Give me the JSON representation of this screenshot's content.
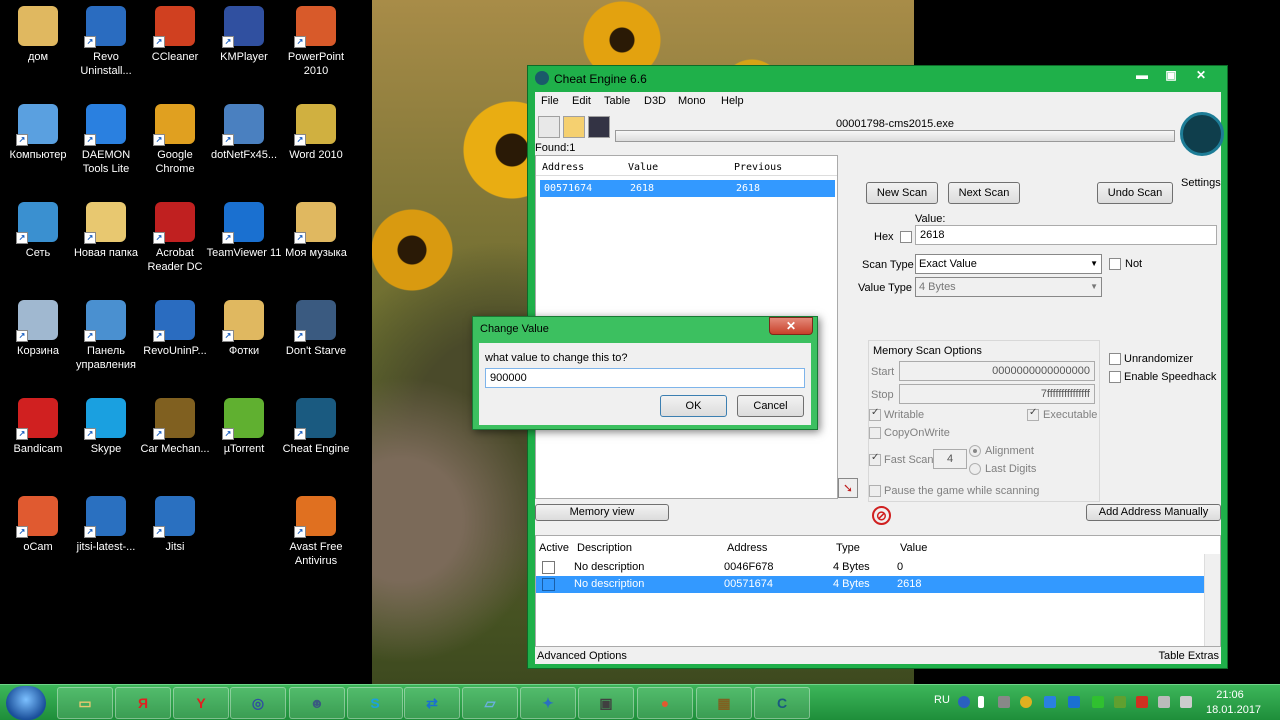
{
  "desktop_icons": [
    {
      "label": "дом",
      "icon": "user-folder-icon",
      "color": "#e0b860"
    },
    {
      "label": "Revo Uninstall...",
      "icon": "revo-icon",
      "color": "#2a6cc0"
    },
    {
      "label": "CCleaner",
      "icon": "ccleaner-icon",
      "color": "#d04020"
    },
    {
      "label": "KMPlayer",
      "icon": "kmplayer-icon",
      "color": "#3050a0"
    },
    {
      "label": "PowerPoint 2010",
      "icon": "powerpoint-icon",
      "color": "#d85a2a"
    },
    {
      "label": "Компьютер",
      "icon": "computer-icon",
      "color": "#5aa0e0"
    },
    {
      "label": "DAEMON Tools Lite",
      "icon": "daemon-tools-icon",
      "color": "#2a80e0"
    },
    {
      "label": "Google Chrome",
      "icon": "chrome-icon",
      "color": "#e0a020"
    },
    {
      "label": "dotNetFx45...",
      "icon": "installer-icon",
      "color": "#4a80c0"
    },
    {
      "label": "Word 2010",
      "icon": "word-icon",
      "color": "#d0b040"
    },
    {
      "label": "Сеть",
      "icon": "network-icon",
      "color": "#3a90d0"
    },
    {
      "label": "Новая папка",
      "icon": "folder-icon",
      "color": "#e8c870"
    },
    {
      "label": "Acrobat Reader DC",
      "icon": "acrobat-icon",
      "color": "#c02020"
    },
    {
      "label": "TeamViewer 11",
      "icon": "teamviewer-icon",
      "color": "#1a70d0"
    },
    {
      "label": "Моя музыка",
      "icon": "music-folder-icon",
      "color": "#e0b860"
    },
    {
      "label": "Корзина",
      "icon": "recycle-bin-icon",
      "color": "#a0b8d0"
    },
    {
      "label": "Панель управления",
      "icon": "control-panel-icon",
      "color": "#4a90d0"
    },
    {
      "label": "RevoUninP...",
      "icon": "revo-pro-icon",
      "color": "#2a6cc0"
    },
    {
      "label": "Фотки",
      "icon": "photos-folder-icon",
      "color": "#e0b860"
    },
    {
      "label": "Don't Starve",
      "icon": "dont-starve-icon",
      "color": "#3a5a80"
    },
    {
      "label": "Bandicam",
      "icon": "bandicam-icon",
      "color": "#d02020"
    },
    {
      "label": "Skype",
      "icon": "skype-icon",
      "color": "#1aa0e0"
    },
    {
      "label": "Car Mechan...",
      "icon": "car-mechanic-icon",
      "color": "#806020"
    },
    {
      "label": "µTorrent",
      "icon": "utorrent-icon",
      "color": "#60b030"
    },
    {
      "label": "Cheat Engine",
      "icon": "cheat-engine-icon",
      "color": "#1a5a80"
    },
    {
      "label": "oCam",
      "icon": "ocam-icon",
      "color": "#e05a30"
    },
    {
      "label": "jitsi-latest-...",
      "icon": "jitsi-icon",
      "color": "#2a70c0"
    },
    {
      "label": "Jitsi",
      "icon": "jitsi-icon",
      "color": "#2a70c0"
    },
    {
      "label": "",
      "icon": "none",
      "color": "#000000"
    },
    {
      "label": "Avast Free Antivirus",
      "icon": "avast-icon",
      "color": "#e07020"
    }
  ],
  "window": {
    "title": "Cheat Engine 6.6",
    "min": "▬",
    "max": "▣",
    "close": "✕",
    "menu": [
      "File",
      "Edit",
      "Table",
      "D3D",
      "Mono",
      "Help"
    ],
    "process": "00001798-cms2015.exe",
    "found": "Found:1",
    "settings": "Settings",
    "results": {
      "columns": [
        "Address",
        "Value",
        "Previous"
      ],
      "rows": [
        {
          "address": "00571674",
          "value": "2618",
          "previous": "2618"
        }
      ]
    },
    "buttons": {
      "new_scan": "New Scan",
      "next_scan": "Next Scan",
      "undo_scan": "Undo Scan"
    },
    "value_label": "Value:",
    "hex_label": "Hex",
    "value": "2618",
    "scan_type_label": "Scan Type",
    "scan_type": "Exact Value",
    "value_type_label": "Value Type",
    "value_type": "4 Bytes",
    "not_label": "Not",
    "memory_scan_options": "Memory Scan Options",
    "start_label": "Start",
    "start_value": "0000000000000000",
    "stop_label": "Stop",
    "stop_value": "7fffffffffffffff",
    "writable": "Writable",
    "executable": "Executable",
    "copyonwrite": "CopyOnWrite",
    "fast_scan": "Fast Scan",
    "fast_scan_value": "4",
    "alignment": "Alignment",
    "last_digits": "Last Digits",
    "pause_game": "Pause the game while scanning",
    "unrandomizer": "Unrandomizer",
    "speedhack": "Enable Speedhack",
    "memory_view": "Memory view",
    "add_manually": "Add Address Manually",
    "address_list": {
      "columns": [
        "Active",
        "Description",
        "Address",
        "Type",
        "Value"
      ],
      "rows": [
        {
          "description": "No description",
          "address": "0046F678",
          "type": "4 Bytes",
          "value": "0"
        },
        {
          "description": "No description",
          "address": "00571674",
          "type": "4 Bytes",
          "value": "2618"
        }
      ]
    },
    "advanced_options": "Advanced Options",
    "table_extras": "Table Extras"
  },
  "dialog": {
    "title": "Change Value",
    "close": "✕",
    "prompt": "what value to change this to?",
    "input": "900000",
    "ok": "OK",
    "cancel": "Cancel"
  },
  "taskbar": {
    "apps": [
      {
        "icon": "explorer-icon",
        "glyph": "▭",
        "color": "#e8c870"
      },
      {
        "icon": "yandex-icon",
        "glyph": "Я",
        "color": "#e02020"
      },
      {
        "icon": "yandex-browser-icon",
        "glyph": "Y",
        "color": "#e02020"
      },
      {
        "icon": "kmplayer-icon",
        "glyph": "◎",
        "color": "#3050a0"
      },
      {
        "icon": "dont-starve-icon",
        "glyph": "☻",
        "color": "#3a5a80"
      },
      {
        "icon": "skype-icon",
        "glyph": "S",
        "color": "#1aa0e0"
      },
      {
        "icon": "teamviewer-icon",
        "glyph": "⇄",
        "color": "#1a70d0"
      },
      {
        "icon": "notebook-icon",
        "glyph": "▱",
        "color": "#6ab0e0"
      },
      {
        "icon": "jitsi-icon",
        "glyph": "✦",
        "color": "#2a70c0"
      },
      {
        "icon": "screen-icon",
        "glyph": "▣",
        "color": "#404040"
      },
      {
        "icon": "ocam-icon",
        "glyph": "●",
        "color": "#e05a30"
      },
      {
        "icon": "car-mechanic-icon",
        "glyph": "▦",
        "color": "#806020"
      },
      {
        "icon": "cheat-engine-icon",
        "glyph": "C",
        "color": "#1a5a80"
      }
    ],
    "lang": "RU",
    "time": "21:06",
    "date": "18.01.2017"
  }
}
